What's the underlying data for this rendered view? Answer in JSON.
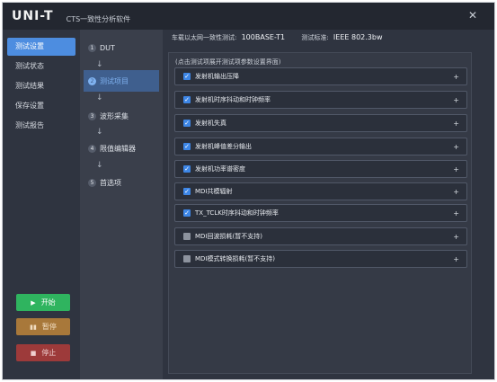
{
  "app": {
    "logo": "UNI-T",
    "title": "CTS一致性分析软件"
  },
  "window": {
    "close_glyph": "✕"
  },
  "nav": {
    "items": [
      {
        "label": "测试设置",
        "active": true
      },
      {
        "label": "测试状态",
        "active": false
      },
      {
        "label": "测试结果",
        "active": false
      },
      {
        "label": "保存设置",
        "active": false
      },
      {
        "label": "测试报告",
        "active": false
      }
    ]
  },
  "controls": {
    "start": {
      "icon": "▶",
      "label": "开始"
    },
    "pause": {
      "icon": "▮▮",
      "label": "暂停"
    },
    "stop": {
      "icon": "■",
      "label": "停止"
    }
  },
  "steps": {
    "items": [
      {
        "num": "1",
        "label": "DUT",
        "active": false
      },
      {
        "num": "2",
        "label": "测试项目",
        "active": true
      },
      {
        "num": "3",
        "label": "波形采集",
        "active": false
      },
      {
        "num": "4",
        "label": "限值编辑器",
        "active": false
      },
      {
        "num": "5",
        "label": "首选项",
        "active": false
      }
    ],
    "arrow": "↓"
  },
  "header": {
    "test_label": "车载以太网一致性测试:",
    "test_value": "100BASE-T1",
    "standard_label": "测试标准:",
    "standard_value": "IEEE 802.3bw"
  },
  "panel": {
    "hint": "(点击测试项展开测试项参数设置界面)",
    "expand_glyph": "+",
    "items": [
      {
        "label": "发射机输出压降",
        "checked": true
      },
      {
        "label": "发射机时序抖动和时钟频率",
        "checked": true
      },
      {
        "label": "发射机失真",
        "checked": true
      },
      {
        "label": "发射机峰值差分输出",
        "checked": true
      },
      {
        "label": "发射机功率谱密度",
        "checked": true
      },
      {
        "label": "MDI共模辐射",
        "checked": true
      },
      {
        "label": "TX_TCLK时序抖动和时钟频率",
        "checked": true
      },
      {
        "label": "MDI回波损耗(暂不支持)",
        "checked": false
      },
      {
        "label": "MDI模式转换损耗(暂不支持)",
        "checked": false
      }
    ]
  },
  "colors": {
    "accent": "#4d8de0",
    "start": "#2fb45f",
    "pause": "#a8783a",
    "stop": "#9d3a3a"
  }
}
